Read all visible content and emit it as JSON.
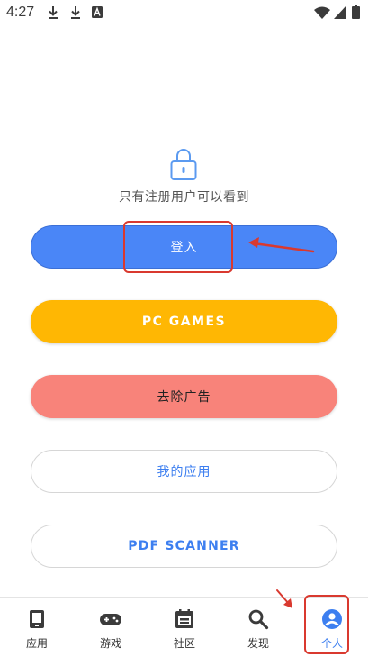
{
  "status_bar": {
    "time": "4:27",
    "icons": [
      "download-icon",
      "download-icon",
      "keyboard-a-icon",
      "wifi-icon",
      "signal-icon",
      "battery-icon"
    ]
  },
  "login_prompt": {
    "text": "只有注册用户可以看到"
  },
  "buttons": {
    "login": "登入",
    "pc_games": "PC GAMES",
    "remove_ads": "去除广告",
    "my_apps": "我的应用",
    "pdf_scanner": "PDF SCANNER"
  },
  "bottom_nav": {
    "items": [
      {
        "label": "应用",
        "icon": "apps-icon"
      },
      {
        "label": "游戏",
        "icon": "gamepad-icon"
      },
      {
        "label": "社区",
        "icon": "community-icon"
      },
      {
        "label": "发现",
        "icon": "search-icon"
      },
      {
        "label": "个人",
        "icon": "profile-icon"
      }
    ],
    "active_index": 4
  },
  "colors": {
    "login": "#4a86f7",
    "pc_games": "#ffb703",
    "remove_ads": "#f8837a",
    "link_text": "#3d7ff0",
    "annotation": "#d9392f"
  }
}
